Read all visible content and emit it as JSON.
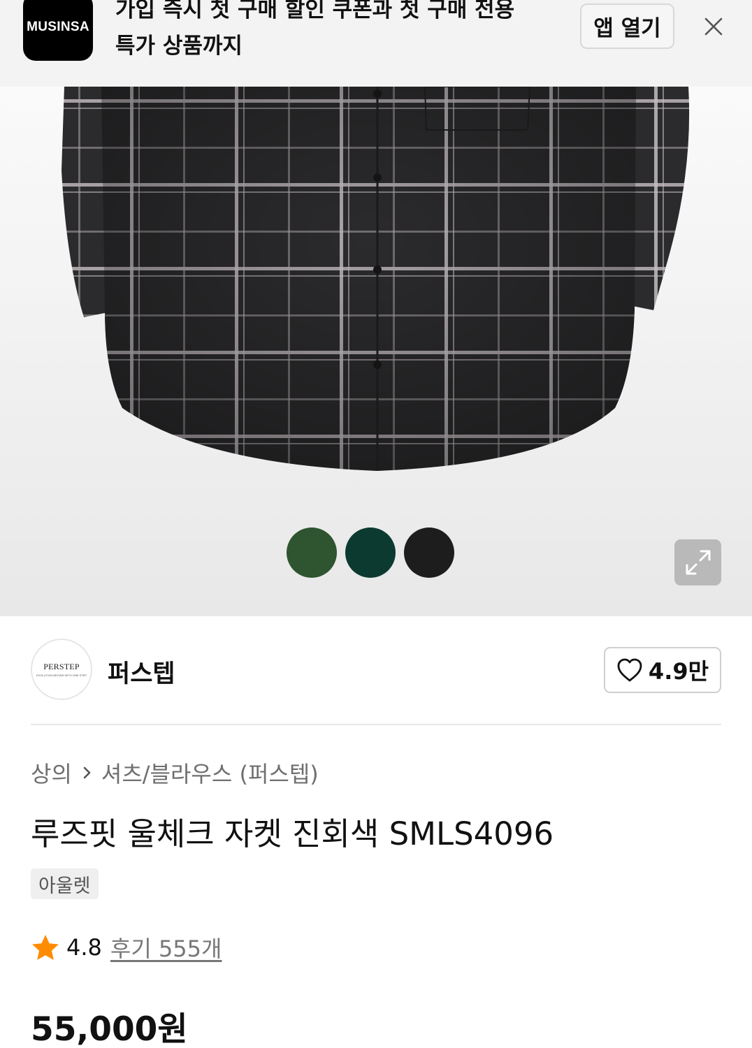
{
  "app_banner": {
    "logo_text": "MUSINSA",
    "line1": "가입 즉시 첫 구매 할인 쿠폰과 첫 구매 전용",
    "line2": "특가 상품까지",
    "open_app_label": "앱 열기",
    "close_icon": "close-icon"
  },
  "product_image": {
    "color_swatches": [
      {
        "name": "green",
        "color": "#2e5430"
      },
      {
        "name": "dark-teal",
        "color": "#0c3a31"
      },
      {
        "name": "black",
        "color": "#1d1d1d"
      }
    ],
    "expand_icon": "expand-icon"
  },
  "brand": {
    "logo_text": "PERSTEP",
    "logo_subtext": "EVOLUTION BEGINS WITH ONE STEP",
    "name": "퍼스텝",
    "like_count": "4.9만",
    "like_icon": "heart-icon"
  },
  "product": {
    "breadcrumb": [
      "상의",
      "셔츠/블라우스 (퍼스텝)"
    ],
    "title": "루즈핏 울체크 자켓 진회색 SMLS4096",
    "tag": "아울렛",
    "rating": "4.8",
    "rating_icon": "star-icon",
    "review_label": "후기 555개",
    "price": "55,000원"
  },
  "colors": {
    "star": "#ff8c00",
    "banner_bg": "#f3f3f3",
    "fabric": "#2b2a2c",
    "plaid_line": "#cfc8cc"
  }
}
